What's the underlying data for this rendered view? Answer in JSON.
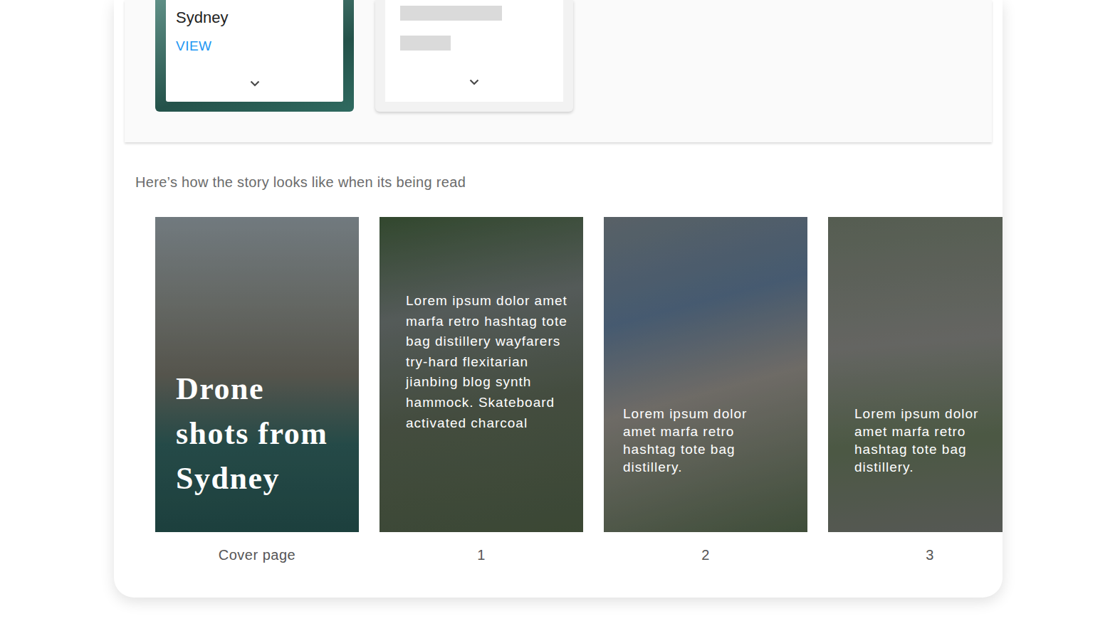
{
  "story_cards": [
    {
      "kind": "loaded",
      "title": "Sydney",
      "action": "VIEW"
    },
    {
      "kind": "loading"
    }
  ],
  "preview_caption": "Here’s how the story looks like when its being read",
  "pages": [
    {
      "kind": "cover",
      "title": "Drone shots from Sydney",
      "label": "Cover page"
    },
    {
      "kind": "long-text",
      "text": "Lorem ipsum dolor amet marfa retro hashtag tote bag distillery wayfarers try-hard flexitarian jianbing blog synth hammock. Skateboard activated charcoal",
      "label": "1"
    },
    {
      "kind": "short-text",
      "text": "Lorem ipsum dolor amet marfa retro hashtag tote bag distillery.",
      "label": "2"
    },
    {
      "kind": "short-text",
      "text": "Lorem ipsum dolor amet marfa retro hashtag tote bag distillery.",
      "label": "3"
    }
  ]
}
